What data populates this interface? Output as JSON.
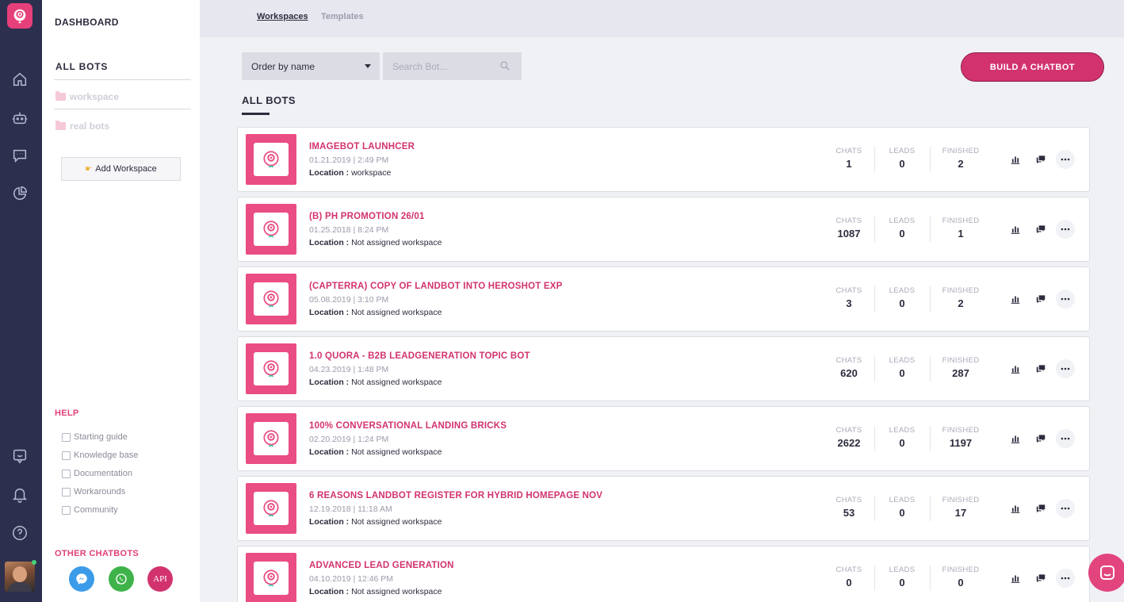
{
  "sidebar": {
    "dashboard": "DASHBOARD",
    "all_bots": "ALL BOTS",
    "workspaces": [
      "workspace",
      "real bots"
    ],
    "add_workspace": "Add Workspace",
    "help_title": "HELP",
    "help_items": [
      "Starting guide",
      "Knowledge base",
      "Documentation",
      "Workarounds",
      "Community"
    ],
    "other_title": "OTHER CHATBOTS",
    "other_api": "API"
  },
  "tabs": [
    "Workspaces",
    "Templates"
  ],
  "toolbar": {
    "order_label": "Order by name",
    "search_placeholder": "Search Bot...",
    "build_label": "BUILD A CHATBOT"
  },
  "main": {
    "title": "ALL BOTS"
  },
  "stat_labels": {
    "chats": "CHATS",
    "leads": "LEADS",
    "finished": "FINISHED"
  },
  "location_label": "Location :",
  "bots": [
    {
      "name": "IMAGEBOT LAUNHCER",
      "date": "01.21.2019 | 2:49 PM",
      "location": "workspace",
      "chats": "1",
      "leads": "0",
      "finished": "2"
    },
    {
      "name": "(B) PH PROMOTION 26/01",
      "date": "01.25.2018 | 8:24 PM",
      "location": "Not assigned workspace",
      "chats": "1087",
      "leads": "0",
      "finished": "1"
    },
    {
      "name": "(CAPTERRA) COPY OF LANDBOT INTO HEROSHOT EXP",
      "date": "05.08.2019 | 3:10 PM",
      "location": "Not assigned workspace",
      "chats": "3",
      "leads": "0",
      "finished": "2"
    },
    {
      "name": "1.0 QUORA - B2B LEADGENERATION TOPIC BOT",
      "date": "04.23.2019 | 1:48 PM",
      "location": "Not assigned workspace",
      "chats": "620",
      "leads": "0",
      "finished": "287"
    },
    {
      "name": "100% CONVERSATIONAL LANDING BRICKS",
      "date": "02.20.2019 | 1:24 PM",
      "location": "Not assigned workspace",
      "chats": "2622",
      "leads": "0",
      "finished": "1197"
    },
    {
      "name": "6 REASONS LANDBOT REGISTER FOR HYBRID HOMEPAGE NOV",
      "date": "12.19.2018 | 11:18 AM",
      "location": "Not assigned workspace",
      "chats": "53",
      "leads": "0",
      "finished": "17"
    },
    {
      "name": "ADVANCED LEAD GENERATION",
      "date": "04.10.2019 | 12:46 PM",
      "location": "Not assigned workspace",
      "chats": "0",
      "leads": "0",
      "finished": "0"
    }
  ],
  "colors": {
    "brand": "#d2336f",
    "rail": "#2d2f4e",
    "messenger": "#3c9be8",
    "whatsapp": "#3fb34a",
    "api": "#d2336f"
  }
}
